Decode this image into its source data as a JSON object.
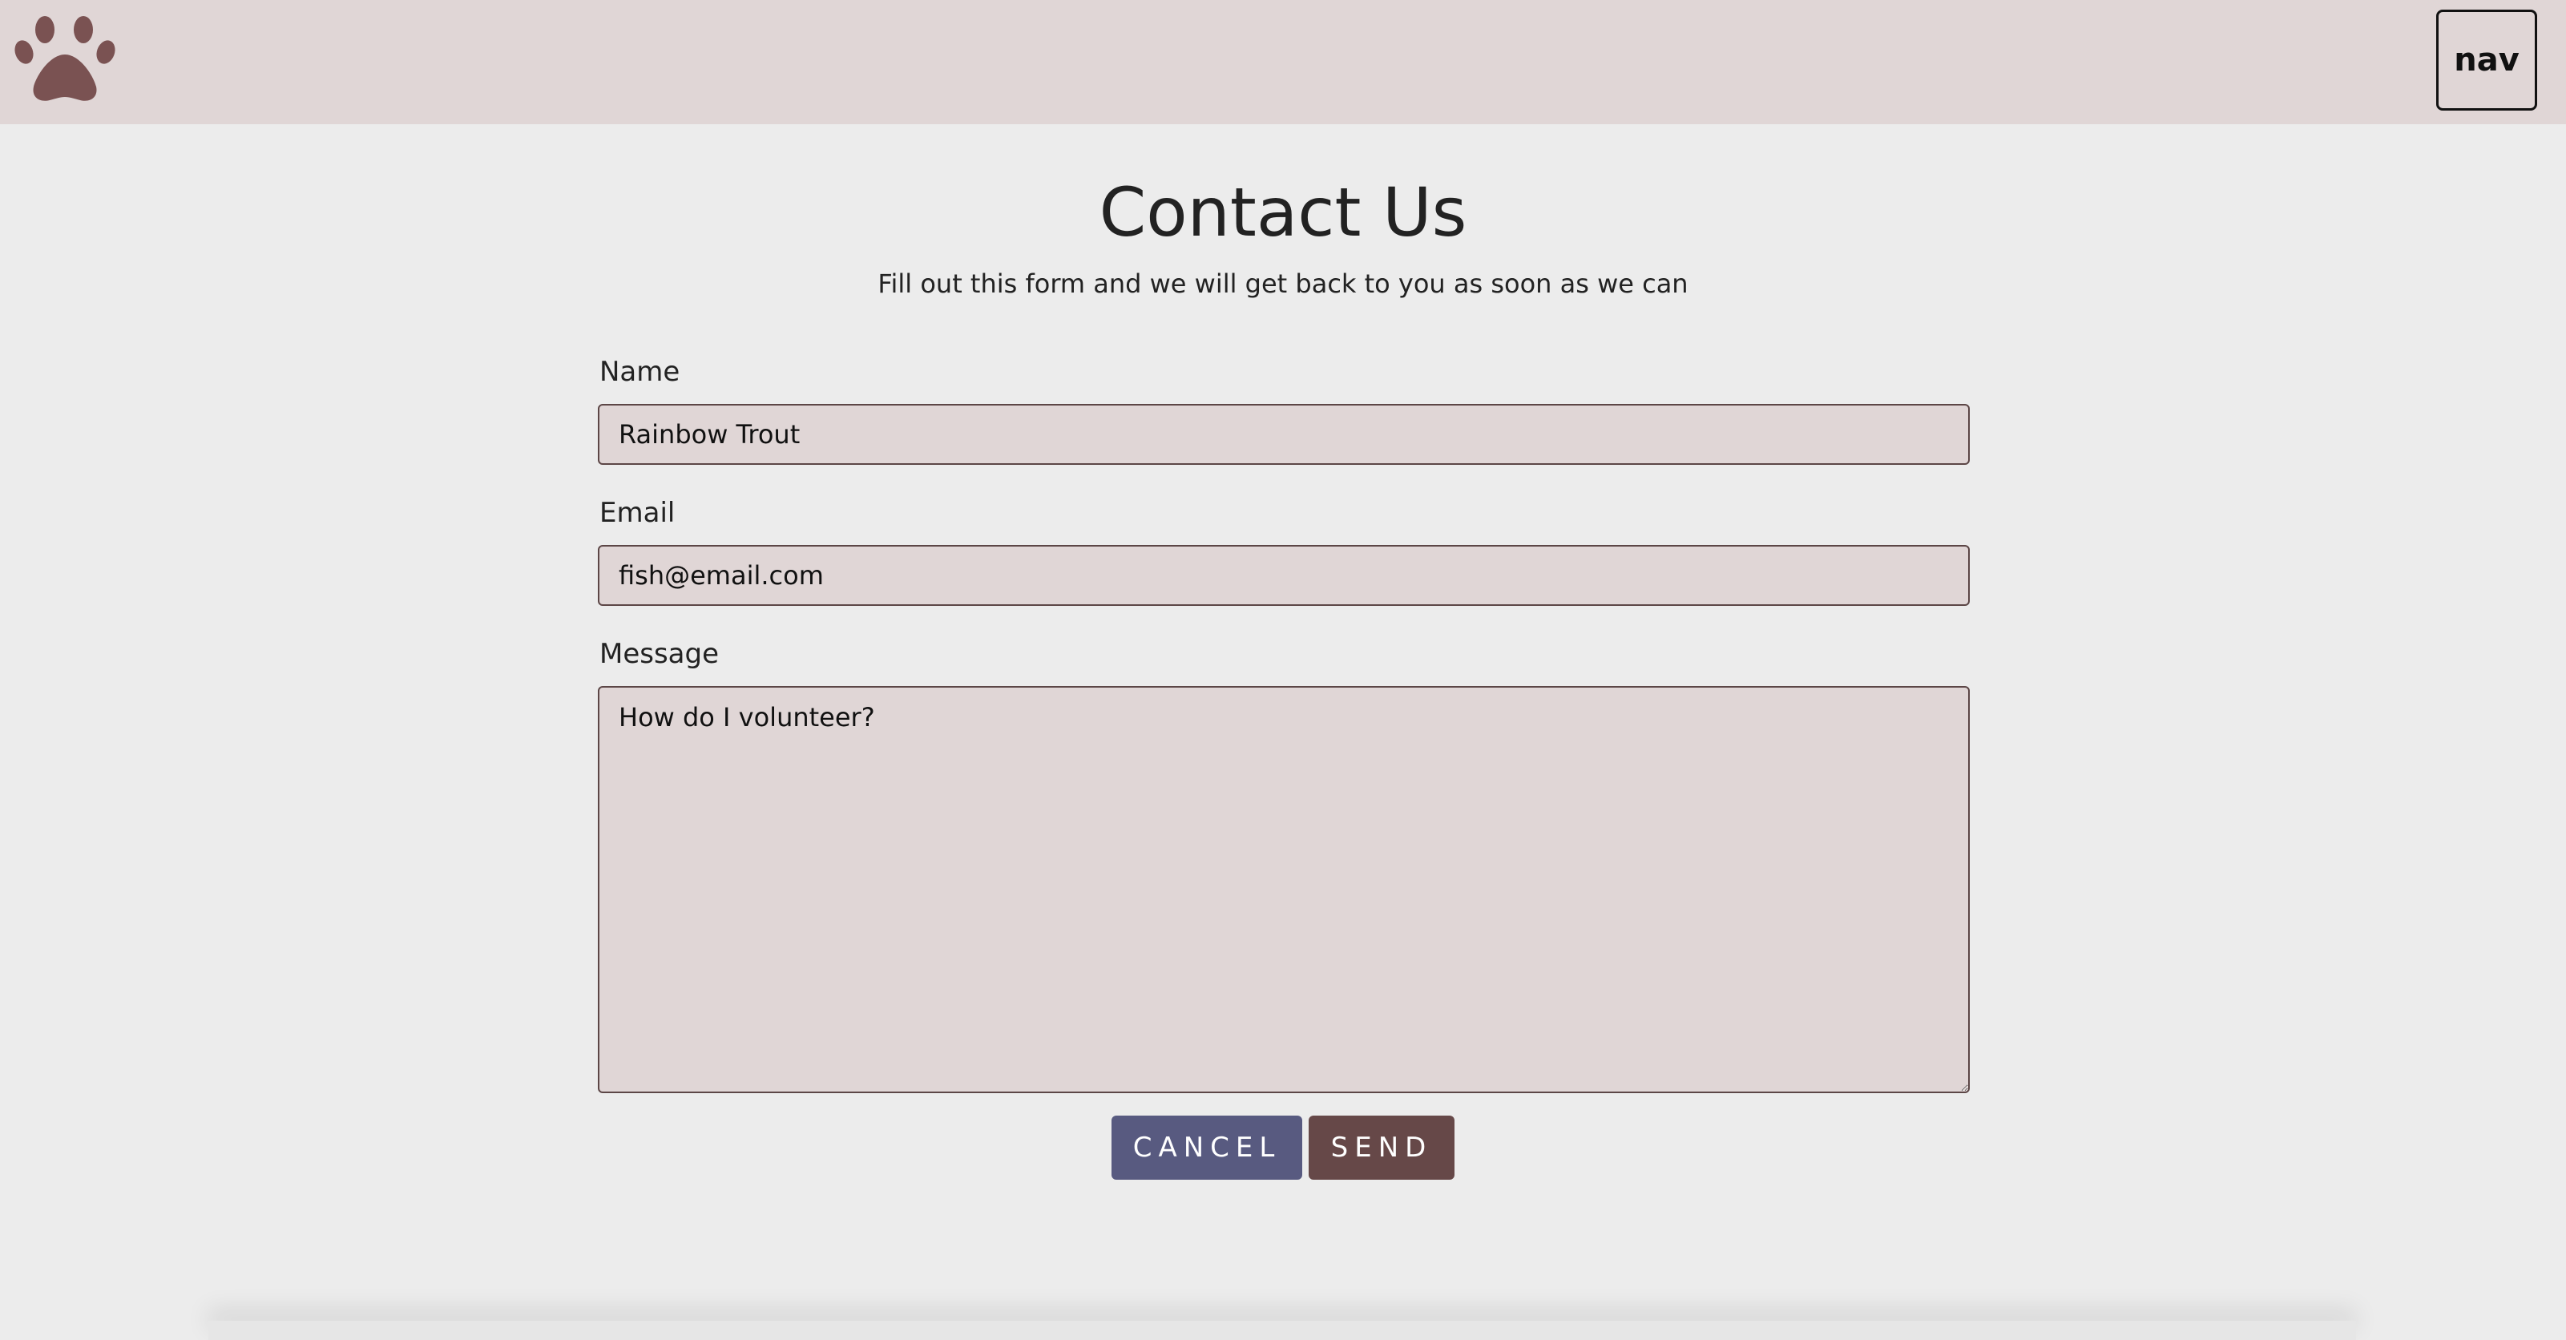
{
  "header": {
    "logo_icon": "paw-icon",
    "nav_label": "nav"
  },
  "main": {
    "title": "Contact Us",
    "subtitle": "Fill out this form and we will get back to you as soon as we can"
  },
  "form": {
    "name": {
      "label": "Name",
      "value": "Rainbow Trout"
    },
    "email": {
      "label": "Email",
      "value": "fish@email.com"
    },
    "message": {
      "label": "Message",
      "value": "How do I volunteer?"
    },
    "cancel_label": "Cancel",
    "send_label": "Send"
  },
  "colors": {
    "header_bg": "#e0d6d6",
    "page_bg": "#ececec",
    "logo": "#7a5252",
    "cancel_button": "#585a80",
    "send_button": "#664848",
    "input_bg": "#e0d6d6",
    "input_border": "#5c4646"
  }
}
